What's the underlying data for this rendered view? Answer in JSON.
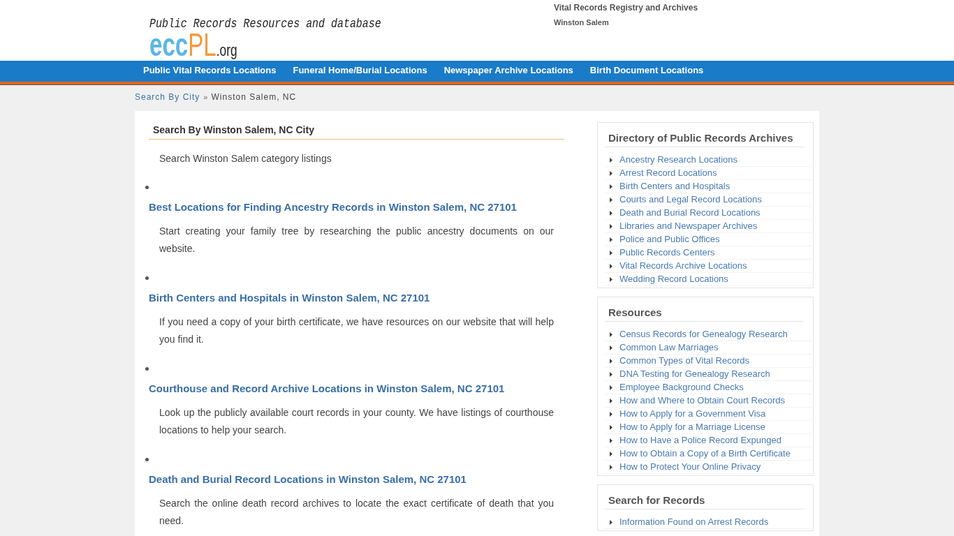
{
  "header": {
    "tagline": "Public Records Resources and database",
    "logo": {
      "primary": "ecc",
      "accent": "PL",
      "suffix": ".org"
    },
    "site_title": "Vital Records Registry and Archives",
    "location": "Winston Salem"
  },
  "nav": {
    "items": [
      "Public Vital Records Locations",
      "Funeral Home/Burial Locations",
      "Newspaper Archive Locations",
      "Birth Document Locations"
    ]
  },
  "breadcrumb": {
    "separator": "»",
    "items": [
      {
        "label": "Search By City",
        "kind": "link"
      },
      {
        "label": "Winston Salem, NC",
        "kind": "current"
      }
    ]
  },
  "main": {
    "heading": "Search By Winston Salem, NC City",
    "intro": "Search Winston Salem category listings",
    "listings": [
      {
        "title": "Best Locations for Finding Ancestry Records in Winston Salem, NC 27101",
        "description": "Start creating your family tree by researching the public ancestry documents on our website."
      },
      {
        "title": "Birth Centers and Hospitals in Winston Salem, NC 27101",
        "description": "If you need a copy of your birth certificate, we have resources on our website that will help you find it."
      },
      {
        "title": "Courthouse and Record Archive Locations in Winston Salem, NC 27101",
        "description": "Look up the publicly available court records in your county. We have listings of courthouse locations to help your search."
      },
      {
        "title": "Death and Burial Record Locations in Winston Salem, NC 27101",
        "description": "Search the online death record archives to locate the exact certificate of death that you need."
      }
    ]
  },
  "sidebar": {
    "sections": [
      {
        "title": "Directory of Public Records Archives",
        "items": [
          "Ancestry Research Locations",
          "Arrest Record Locations",
          "Birth Centers and Hospitals",
          "Courts and Legal Record Locations",
          "Death and Burial Record Locations",
          "Libraries and Newspaper Archives",
          "Police and Public Offices",
          "Public Records Centers",
          "Vital Records Archive Locations",
          "Wedding Record Locations"
        ]
      },
      {
        "title": "Resources",
        "items": [
          "Census Records for Genealogy Research",
          "Common Law Marriages",
          "Common Types of Vital Records",
          "DNA Testing for Genealogy Research",
          "Employee Background Checks",
          "How and Where to Obtain Court Records",
          "How to Apply for a Government Visa",
          "How to Apply for a Marriage License",
          "How to Have a Police Record Expunged",
          "How to Obtain a Copy of a Birth Certificate",
          "How to Protect Your Online Privacy"
        ]
      },
      {
        "title": "Search for Records",
        "items": [
          "Information Found on Arrest Records"
        ]
      }
    ]
  }
}
